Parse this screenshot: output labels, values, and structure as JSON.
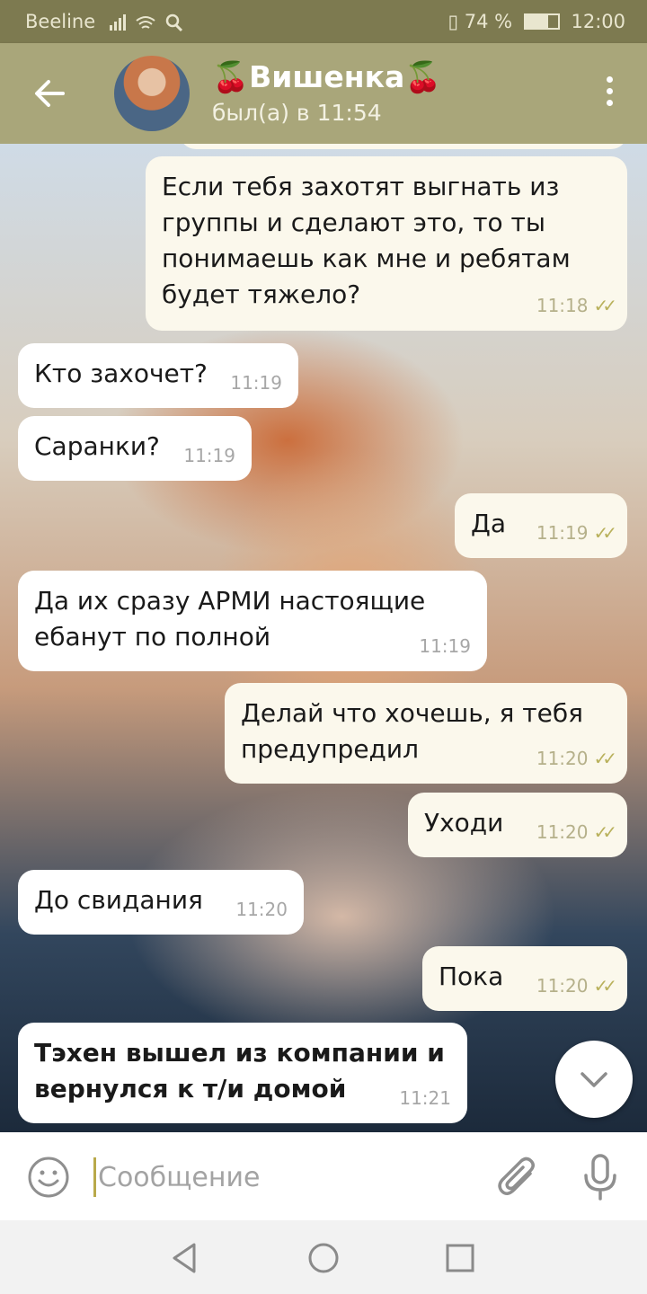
{
  "status_bar": {
    "carrier": "Beeline",
    "battery": "74 %",
    "time": "12:00"
  },
  "header": {
    "title": "🍒Вишенка🍒",
    "subtitle": "был(а) в 11:54"
  },
  "messages": [
    {
      "text": "Если тебя захотят выгнать из группы и сделают это, то ты понимаешь как мне и ребятам будет тяжело?",
      "time": "11:18",
      "read_mark": "✓✓"
    },
    {
      "text": "Кто захочет?",
      "time": "11:19"
    },
    {
      "text": "Саранки?",
      "time": "11:19"
    },
    {
      "text": "Да",
      "time": "11:19",
      "read_mark": "✓✓"
    },
    {
      "text": "Да их сразу АРМИ настоящие ебанут по полной",
      "time": "11:19"
    },
    {
      "text": "Делай что хочешь, я тебя предупредил",
      "time": "11:20",
      "read_mark": "✓✓"
    },
    {
      "text": "Уходи",
      "time": "11:20",
      "read_mark": "✓✓"
    },
    {
      "text": "До свидания",
      "time": "11:20"
    },
    {
      "text": "Пока",
      "time": "11:20",
      "read_mark": "✓✓"
    },
    {
      "text": "Тэхен вышел из компании и вернулся к т/и домой",
      "time": "11:21"
    }
  ],
  "composer": {
    "placeholder": "Сообщение"
  }
}
